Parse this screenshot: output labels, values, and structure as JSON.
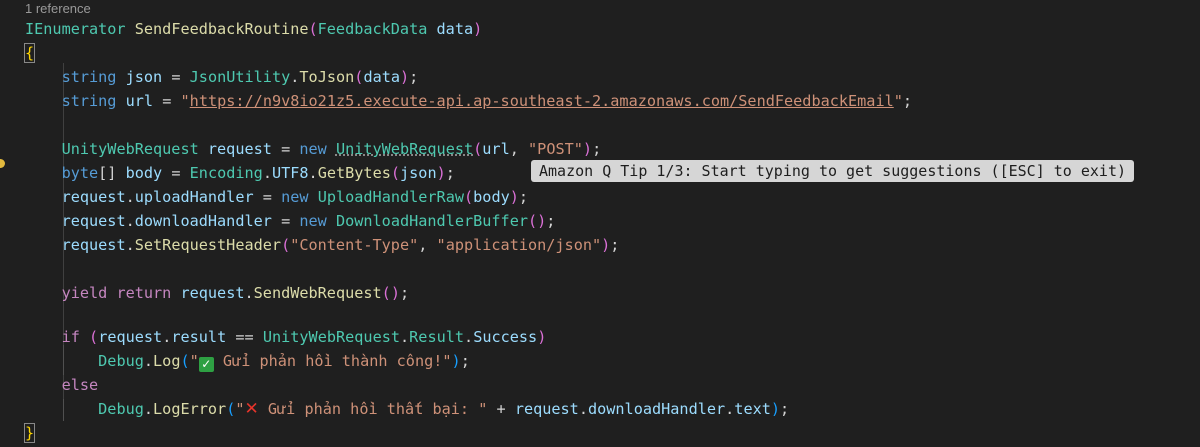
{
  "codelens": "1 reference",
  "tip": "Amazon Q Tip 1/3: Start typing to get suggestions ([ESC] to exit)",
  "code": {
    "l1": {
      "t1": "IEnumerator",
      "t2": "SendFeedbackRoutine",
      "t3": "(",
      "t4": "FeedbackData",
      "t5": "data",
      "t6": ")"
    },
    "l2": {
      "t1": "{"
    },
    "l3": {
      "t1": "string",
      "t2": "json",
      "t3": "=",
      "t4": "JsonUtility",
      "t5": ".",
      "t6": "ToJson",
      "t7": "(",
      "t8": "data",
      "t9": ")",
      "t10": ";"
    },
    "l4": {
      "t1": "string",
      "t2": "url",
      "t3": "=",
      "t4": "\"",
      "t5": "https://n9v8io21z5.execute-api.ap-southeast-2.amazonaws.com/SendFeedbackEmail",
      "t6": "\"",
      "t7": ";"
    },
    "l6": {
      "t1": "UnityWebRequest",
      "t2": "request",
      "t3": "=",
      "t4": "new",
      "t5": "UnityWebRequest",
      "t6": "(",
      "t7": "url",
      "t8": ",",
      "t9": "\"POST\"",
      "t10": ")",
      "t11": ";"
    },
    "l7": {
      "t1": "byte",
      "t2": "[]",
      "t3": "body",
      "t4": "=",
      "t5": "Encoding",
      "t6": ".",
      "t7": "UTF8",
      "t8": ".",
      "t9": "GetBytes",
      "t10": "(",
      "t11": "json",
      "t12": ")",
      "t13": ";"
    },
    "l8": {
      "t1": "request",
      "t2": ".",
      "t3": "uploadHandler",
      "t4": "=",
      "t5": "new",
      "t6": "UploadHandlerRaw",
      "t7": "(",
      "t8": "body",
      "t9": ")",
      "t10": ";"
    },
    "l9": {
      "t1": "request",
      "t2": ".",
      "t3": "downloadHandler",
      "t4": "=",
      "t5": "new",
      "t6": "DownloadHandlerBuffer",
      "t7": "()",
      "t8": ";"
    },
    "l10": {
      "t1": "request",
      "t2": ".",
      "t3": "SetRequestHeader",
      "t4": "(",
      "t5": "\"Content-Type\"",
      "t6": ",",
      "t7": "\"application/json\"",
      "t8": ")",
      "t9": ";"
    },
    "l12": {
      "t1": "yield",
      "t2": "return",
      "t3": "request",
      "t4": ".",
      "t5": "SendWebRequest",
      "t6": "()",
      "t7": ";"
    },
    "l14": {
      "t1": "if",
      "t2": "(",
      "t3": "request",
      "t4": ".",
      "t5": "result",
      "t6": "==",
      "t7": "UnityWebRequest",
      "t8": ".",
      "t9": "Result",
      "t10": ".",
      "t11": "Success",
      "t12": ")"
    },
    "l15": {
      "t1": "Debug",
      "t2": ".",
      "t3": "Log",
      "t4": "(",
      "t5": "\"",
      "t6": "✓",
      "t7": " Gửi phản hồi thành công!\"",
      "t8": ")",
      "t9": ";"
    },
    "l16": {
      "t1": "else"
    },
    "l17": {
      "t1": "Debug",
      "t2": ".",
      "t3": "LogError",
      "t4": "(",
      "t5": "\"",
      "t6": "✕",
      "t7": " Gửi phản hồi thất bại: \"",
      "t8": "+",
      "t9": "request",
      "t10": ".",
      "t11": "downloadHandler",
      "t12": ".",
      "t13": "text",
      "t14": ")",
      "t15": ";"
    },
    "l18": {
      "t1": "}"
    }
  }
}
